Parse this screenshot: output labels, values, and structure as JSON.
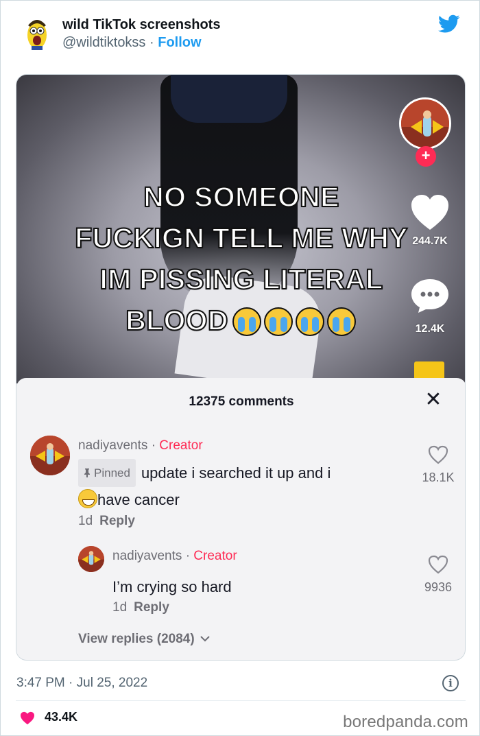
{
  "account": {
    "name": "wild TikTok screenshots",
    "handle": "@wildtiktokss",
    "separator": "·",
    "follow_label": "Follow"
  },
  "video": {
    "overlay_lines": [
      "NO SOMEONE",
      "FUCKIGN TELL ME WHY",
      "IM PISSING LITERAL",
      "BLOOD"
    ],
    "overlay_emoji": "loudly-crying-face x4",
    "like_count": "244.7K",
    "comment_count": "12.4K",
    "plus_label": "+"
  },
  "comments_panel": {
    "title": "12375 comments",
    "close_label": "✕",
    "pinned_comment": {
      "author": "nadiyavents",
      "separator": "·",
      "badge": "Creator",
      "pinned_label": "Pinned",
      "text_line1": "update i searched it up and i",
      "text_line2": "have cancer",
      "age": "1d",
      "reply_label": "Reply",
      "likes": "18.1K"
    },
    "reply": {
      "author": "nadiyavents",
      "separator": "·",
      "badge": "Creator",
      "text": "I’m crying so hard",
      "age": "1d",
      "reply_label": "Reply",
      "likes": "9936"
    },
    "view_replies": "View replies (2084)"
  },
  "tweet_footer": {
    "time": "3:47 PM · Jul 25, 2022",
    "info_label": "i",
    "likes": "43.4K"
  },
  "watermark": "boredpanda.com",
  "colors": {
    "twitter_blue": "#1d9bf0",
    "tiktok_red": "#fe2c55",
    "heart_red": "#f91880"
  }
}
